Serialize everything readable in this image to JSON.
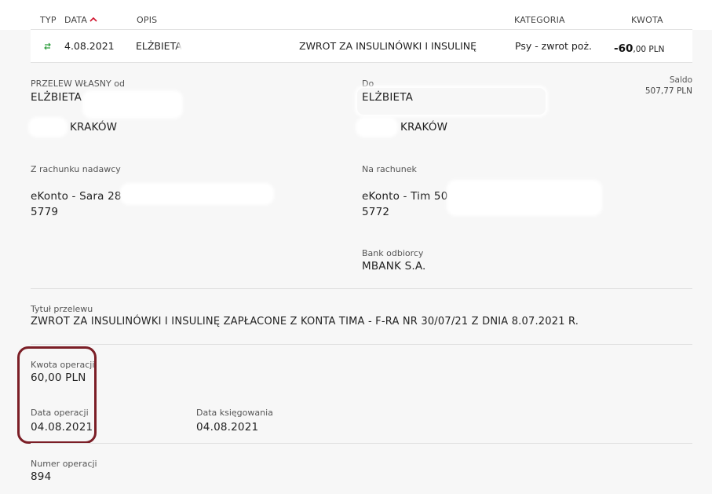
{
  "table_header": {
    "typ": "TYP",
    "data": "DATA",
    "opis": "OPIS",
    "kategoria": "KATEGORIA",
    "kwota": "KWOTA"
  },
  "transaction": {
    "date": "4.08.2021",
    "name": "ELŻBIETA",
    "title": "ZWROT ZA INSULINÓWKI I INSULINĘ",
    "category": "Psy - zwrot poż.",
    "amount_main": "-60",
    "amount_decimal": ",00 PLN"
  },
  "details": {
    "sender_label": "PRZELEW WŁASNY od",
    "sender_name": "ELŻBIETA",
    "sender_city": "KRAKÓW",
    "recipient_label": "Do",
    "recipient_name": "ELŻBIETA",
    "recipient_city": "KRAKÓW",
    "saldo_label": "Saldo",
    "saldo_value": "507,77 PLN",
    "from_account_label": "Z rachunku nadawcy",
    "from_account_name": "eKonto - Sara 28",
    "from_account_number": "5779",
    "to_account_label": "Na rachunek",
    "to_account_name": "eKonto - Tim 50",
    "to_account_number": "5772",
    "bank_label": "Bank odbiorcy",
    "bank_value": "MBANK S.A.",
    "transfer_title_label": "Tytuł przelewu",
    "transfer_title_value": "ZWROT ZA INSULINÓWKI I INSULINĘ ZAPŁACONE Z KONTA TIMA - F-RA NR 30/07/21 Z DNIA 8.07.2021 R.",
    "amount_label": "Kwota operacji",
    "amount_value": "60,00 PLN",
    "operation_date_label": "Data operacji",
    "operation_date_value": "04.08.2021",
    "booking_date_label": "Data księgowania",
    "booking_date_value": "04.08.2021",
    "operation_number_label": "Numer operacji",
    "operation_number_value": "894"
  },
  "colors": {
    "highlight": "#7b1e26",
    "sort_arrow": "#d0112b",
    "type_icon": "#2e9e3e"
  },
  "icons": {
    "type": "transfer-arrows-icon",
    "sort": "chevron-up-icon"
  }
}
